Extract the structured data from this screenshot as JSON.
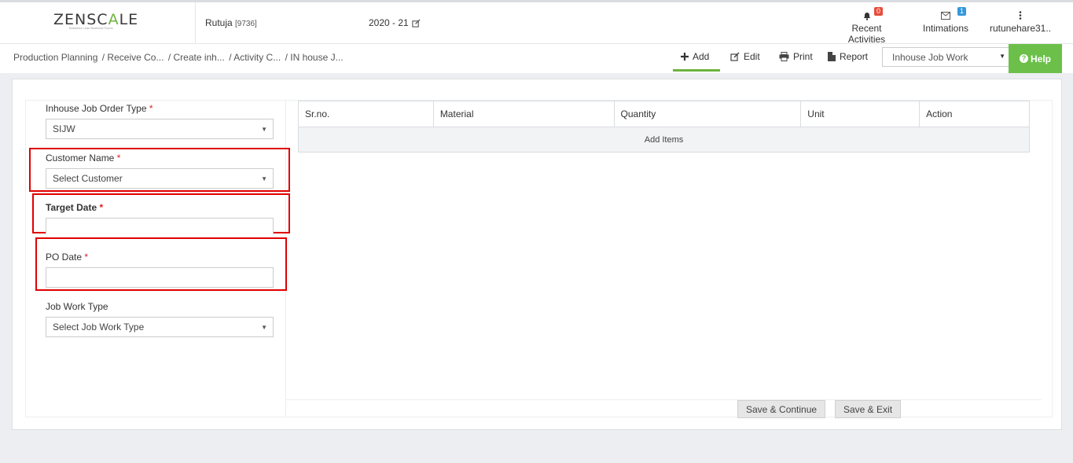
{
  "header": {
    "logo_text_1": "ZENSC",
    "logo_text_accent": "A",
    "logo_text_2": "LE",
    "logo_tagline": "Business Lean Business Focus",
    "user_name": "Rutuja",
    "user_id": "[9736]",
    "financial_year": "2020 - 21",
    "recent_activities_label": "Recent Activities",
    "recent_activities_count": "0",
    "intimations_label": "Intimations",
    "intimations_count": "1",
    "account_label": "rutunehare31.."
  },
  "breadcrumb": [
    "Production Planning",
    "/ Receive Co...",
    "/ Create inh...",
    "/ Activity C...",
    "/ IN house J..."
  ],
  "toolbar": {
    "add_label": "Add",
    "edit_label": "Edit",
    "print_label": "Print",
    "report_label": "Report",
    "module_select_value": "Inhouse Job Work",
    "help_label": "Help"
  },
  "form": {
    "job_order_type_label": "Inhouse Job Order Type",
    "job_order_type_value": "SIJW",
    "customer_label": "Customer Name",
    "customer_value": "Select Customer",
    "target_date_label": "Target Date",
    "target_date_value": "",
    "po_date_label": "PO Date",
    "po_date_value": "",
    "job_work_type_label": "Job Work Type",
    "job_work_type_value": "Select Job Work Type",
    "required_mark": "*"
  },
  "items_table": {
    "columns": [
      "Sr.no.",
      "Material",
      "Quantity",
      "Unit",
      "Action"
    ],
    "add_items_label": "Add Items"
  },
  "actions": {
    "save_continue_label": "Save & Continue",
    "save_exit_label": "Save & Exit"
  }
}
